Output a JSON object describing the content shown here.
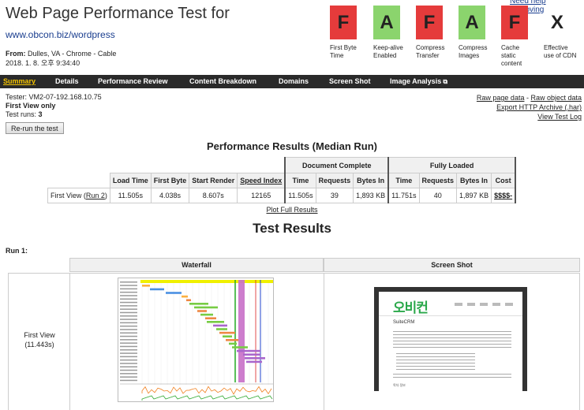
{
  "header": {
    "help_link": "Need help improving?",
    "title": "Web Page Performance Test for",
    "url": "www.obcon.biz/wordpress",
    "from_label": "From:",
    "from_value": "Dulles, VA - Chrome - Cable",
    "datetime": "2018. 1. 8. 오후 9:34:40"
  },
  "grades": [
    {
      "grade": "F",
      "label_lines": [
        "First Byte",
        "Time"
      ],
      "color": "#e53b3b"
    },
    {
      "grade": "A",
      "label_lines": [
        "Keep-alive",
        "Enabled"
      ],
      "color": "#8bd46d"
    },
    {
      "grade": "F",
      "label_lines": [
        "Compress",
        "Transfer"
      ],
      "color": "#e53b3b"
    },
    {
      "grade": "A",
      "label_lines": [
        "Compress",
        "Images"
      ],
      "color": "#8bd46d"
    },
    {
      "grade": "F",
      "label_lines": [
        "Cache",
        "static",
        "content"
      ],
      "color": "#e53b3b"
    },
    {
      "grade": "X",
      "label_lines": [
        "Effective",
        "use of CDN"
      ],
      "color": "#ffffff"
    }
  ],
  "nav": {
    "items": [
      "Summary",
      "Details",
      "Performance Review",
      "Content Breakdown",
      "Domains",
      "Screen Shot",
      "Image Analysis"
    ],
    "active": "Summary",
    "external_icon": "external-link-icon"
  },
  "info": {
    "tester": "Tester: VM2-07-192.168.10.75",
    "view": "First View only",
    "runs_label": "Test runs:",
    "runs_value": "3",
    "rerun_button": "Re-run the test"
  },
  "links": {
    "raw_page": "Raw page data",
    "separator": " - ",
    "raw_object": "Raw object data",
    "export": "Export HTTP Archive (.har)",
    "view_log": "View Test Log"
  },
  "perf": {
    "title": "Performance Results (Median Run)",
    "group_doc": "Document Complete",
    "group_full": "Fully Loaded",
    "headers": [
      "Load Time",
      "First Byte",
      "Start Render",
      "Speed Index",
      "Time",
      "Requests",
      "Bytes In",
      "Time",
      "Requests",
      "Bytes In",
      "Cost"
    ],
    "row_label": "First View (",
    "row_run_link": "Run 2",
    "row_label_end": ")",
    "values": [
      "11.505s",
      "4.038s",
      "8.607s",
      "12165",
      "11.505s",
      "39",
      "1,893 KB",
      "11.751s",
      "40",
      "1,897 KB",
      "$$$$-"
    ],
    "plot_link": "Plot Full Results"
  },
  "results": {
    "title": "Test Results",
    "run_label": "Run 1:",
    "waterfall_header": "Waterfall",
    "screenshot_header": "Screen Shot",
    "first_view": "First View",
    "first_view_time": "(11.443s)"
  },
  "screenshot_page": {
    "logo": "오비컨",
    "heading": "SuiteCRM",
    "footer_text": "목차 정보"
  },
  "colors": {
    "fail": "#e53b3b",
    "pass": "#8bd46d",
    "nav_bg": "#2a2a2a",
    "nav_active": "#f5c400",
    "link": "#1a3e8f"
  }
}
